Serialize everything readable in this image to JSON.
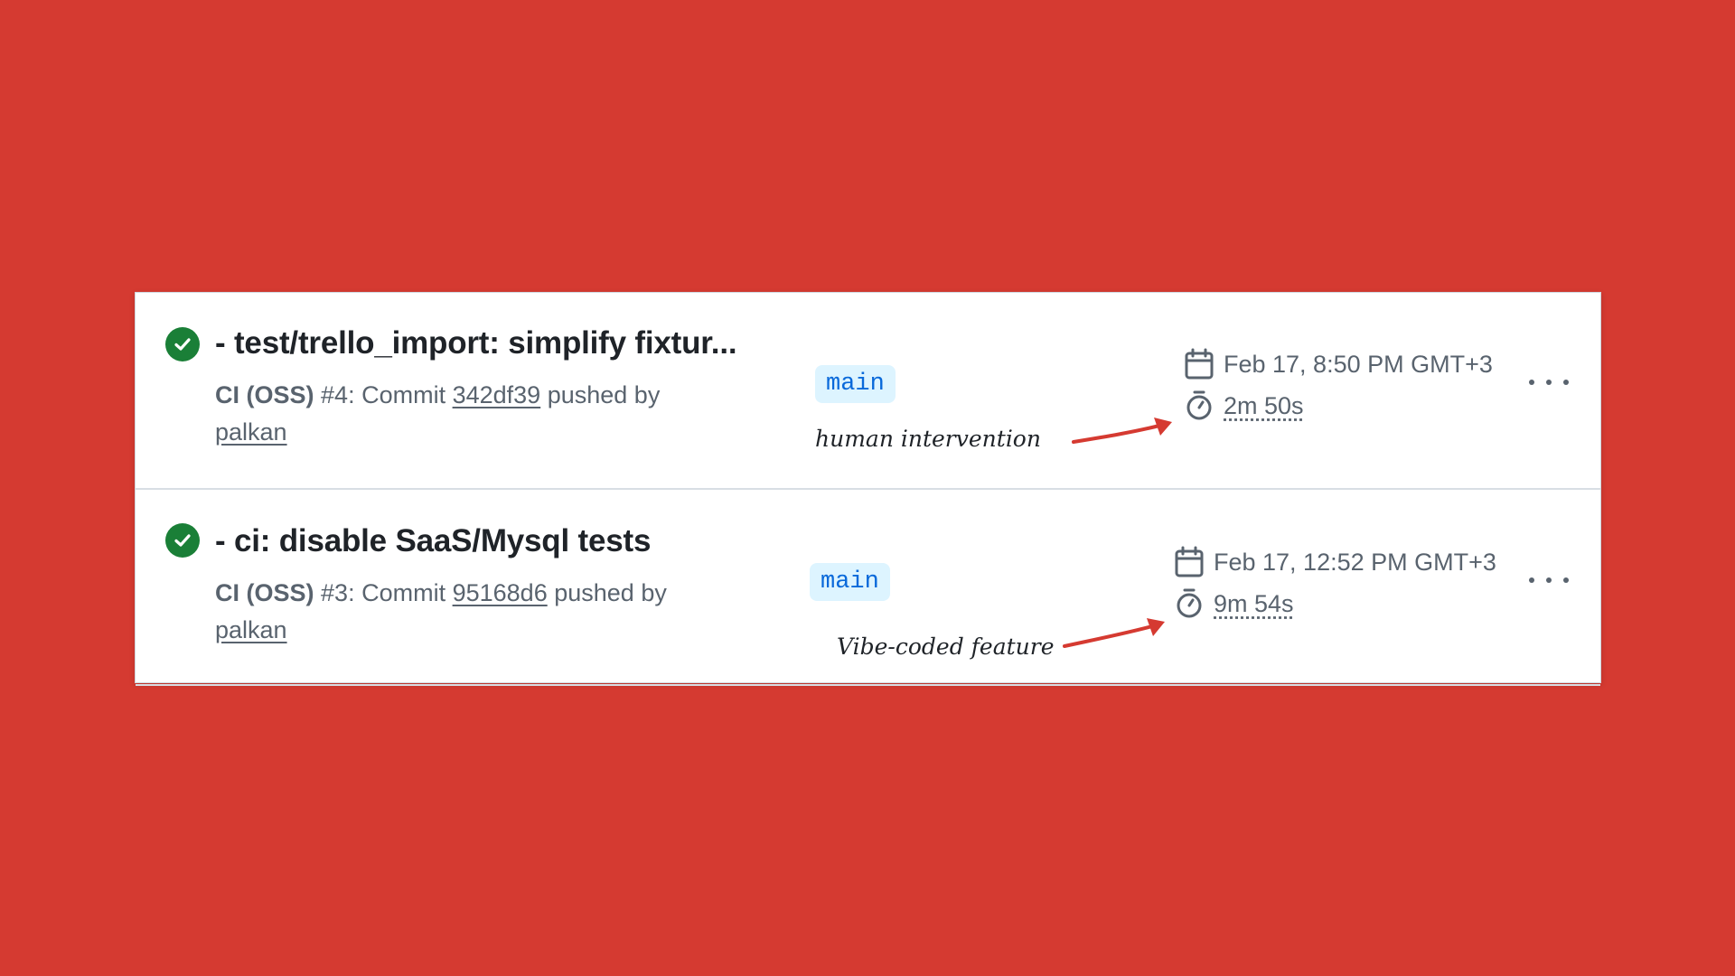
{
  "runs": [
    {
      "status": "success",
      "title": "- test/trello_import: simplify fixtur...",
      "workflow": "CI (OSS)",
      "run_number": "#4",
      "commit_prefix": ": Commit",
      "commit_sha": "342df39",
      "pushed_by_label": "pushed by",
      "author": "palkan",
      "branch": "main",
      "date": "Feb 17, 8:50 PM GMT+3",
      "duration": "2m 50s",
      "annotation": "human intervention"
    },
    {
      "status": "success",
      "title": "- ci: disable SaaS/Mysql tests",
      "workflow": "CI (OSS)",
      "run_number": "#3",
      "commit_prefix": ": Commit",
      "commit_sha": "95168d6",
      "pushed_by_label": "pushed by",
      "author": "palkan",
      "branch": "main",
      "date": "Feb 17, 12:52 PM GMT+3",
      "duration": "9m 54s",
      "annotation": "Vibe-coded feature"
    }
  ],
  "colors": {
    "background": "#d53a31",
    "success": "#1a7f37",
    "branch_text": "#0969da",
    "branch_bg": "#ddf4ff",
    "annotation_arrow": "#d53a31"
  }
}
